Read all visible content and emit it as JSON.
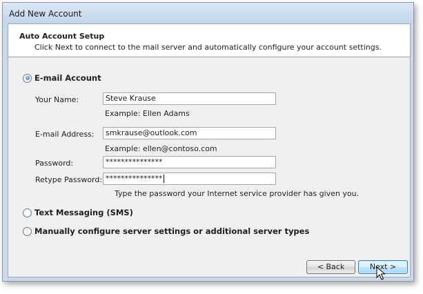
{
  "window": {
    "title": "Add New Account"
  },
  "header": {
    "title": "Auto Account Setup",
    "description": "Click Next to connect to the mail server and automatically configure your account settings."
  },
  "email_account": {
    "label": "E-mail Account",
    "selected": true,
    "fields": {
      "name": {
        "label": "Your Name:",
        "value": "Steve Krause",
        "hint": "Example: Ellen Adams"
      },
      "email": {
        "label": "E-mail Address:",
        "value": "smkrause@outlook.com",
        "hint": "Example: ellen@contoso.com"
      },
      "password": {
        "label": "Password:",
        "value": "***************"
      },
      "retype_password": {
        "label": "Retype Password:",
        "value": "***************"
      }
    },
    "password_hint": "Type the password your Internet service provider has given you."
  },
  "options": {
    "sms": {
      "label": "Text Messaging (SMS)",
      "selected": false
    },
    "manual": {
      "label": "Manually configure server settings or additional server types",
      "selected": false
    }
  },
  "buttons": {
    "back": "< Back",
    "next": "Next >"
  }
}
